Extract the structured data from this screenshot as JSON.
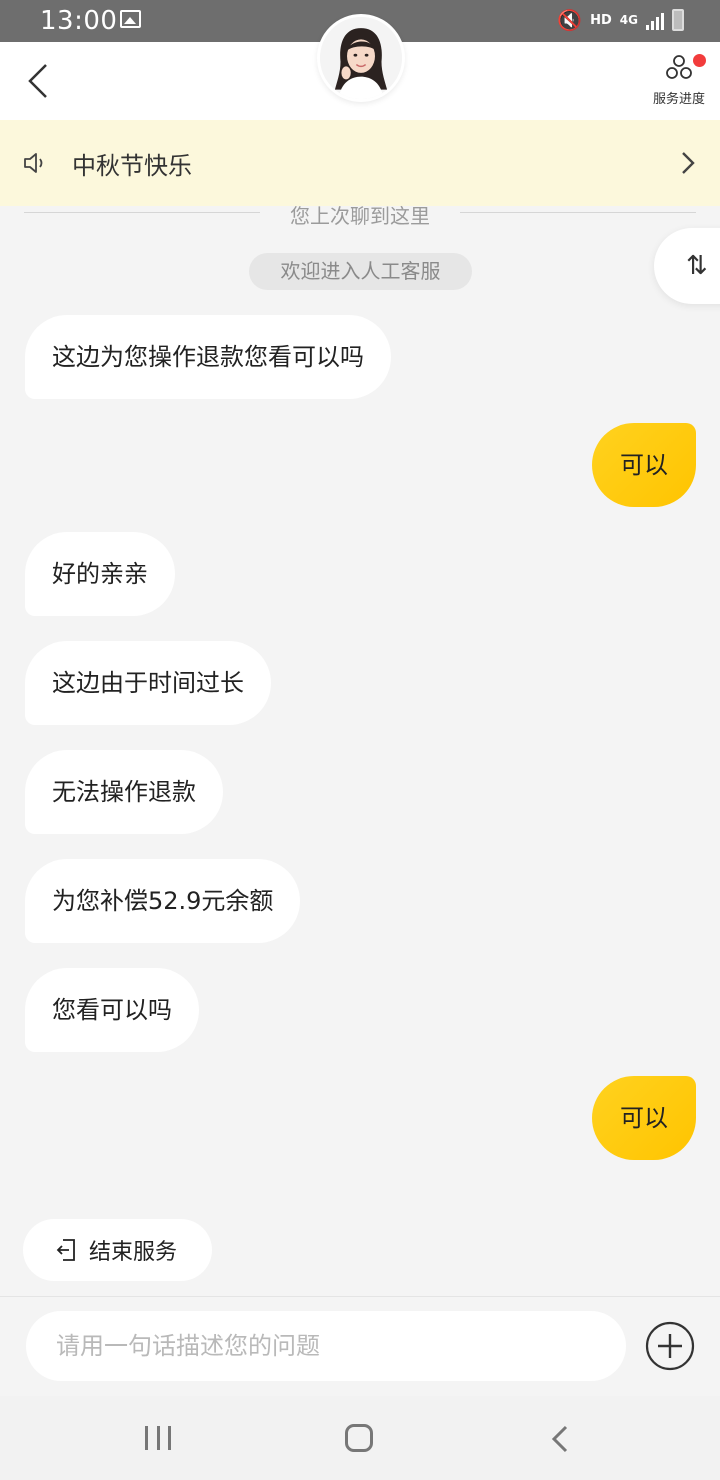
{
  "status_bar": {
    "time": "13:00",
    "network_hd": "HD",
    "network_4g": "4G"
  },
  "header": {
    "service_progress_label": "服务进度"
  },
  "notice": {
    "text": "中秋节快乐"
  },
  "history": {
    "divider_text": "您上次聊到这里",
    "system_message": "欢迎进入人工客服"
  },
  "messages": [
    {
      "side": "left",
      "text": "这边为您操作退款您看可以吗"
    },
    {
      "side": "right",
      "text": "可以"
    },
    {
      "side": "left",
      "text": "好的亲亲"
    },
    {
      "side": "left",
      "text": "这边由于时间过长"
    },
    {
      "side": "left",
      "text": "无法操作退款"
    },
    {
      "side": "left",
      "text": "为您补偿52.9元余额"
    },
    {
      "side": "left",
      "text": "您看可以吗"
    },
    {
      "side": "right",
      "text": "可以"
    }
  ],
  "actions": {
    "end_service_label": "结束服务"
  },
  "input": {
    "placeholder": "请用一句话描述您的问题",
    "value": ""
  },
  "colors": {
    "accent": "#ffc400",
    "notice_bg": "#fcf8dc",
    "badge_red": "#f23c3c"
  }
}
